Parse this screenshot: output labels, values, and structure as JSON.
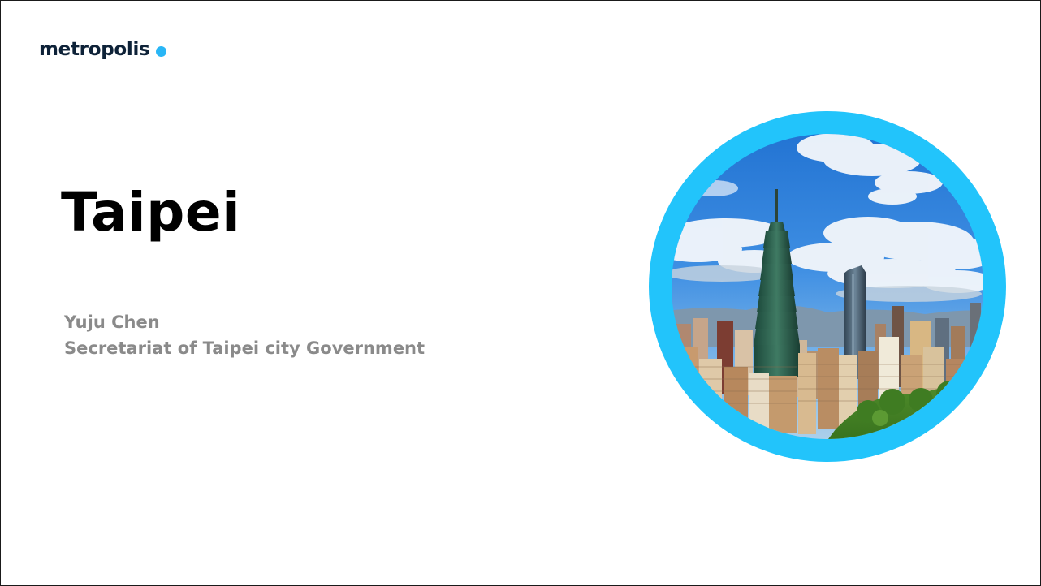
{
  "logo": {
    "text": "metropolis",
    "dot_color": "#29b6f6"
  },
  "slide": {
    "title": "Taipei",
    "author_name": "Yuju Chen",
    "author_affiliation": "Secretariat of Taipei city Government"
  },
  "image": {
    "subject": "taipei-skyline-photo",
    "ring_color": "#22c4fb"
  }
}
